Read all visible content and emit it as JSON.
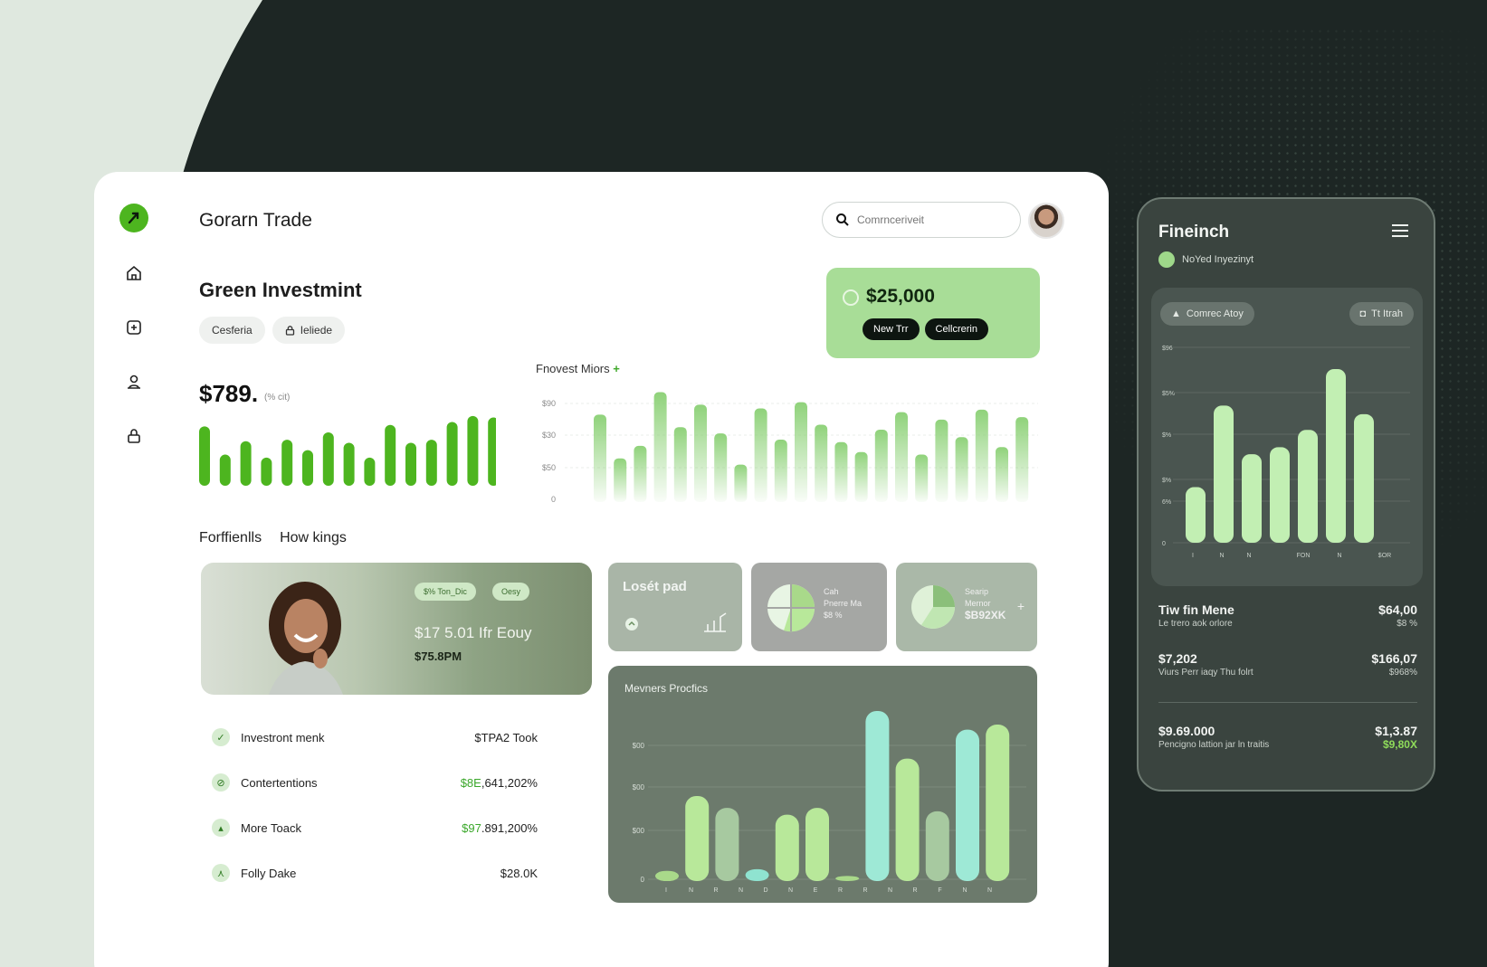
{
  "app": {
    "title": "Gorarn Trade"
  },
  "search": {
    "placeholder": "Comrnceriveit"
  },
  "page": {
    "title": "Green Investmint"
  },
  "chips": [
    {
      "label": "Cesferia",
      "icon": ""
    },
    {
      "label": "Ieliede",
      "icon": "lock-icon"
    }
  ],
  "promo": {
    "amount": "$25,000",
    "btn1": "New Trr",
    "btn2": "Cellcrerin"
  },
  "summary": {
    "value": "$789.",
    "sub": "(% cit)"
  },
  "chart_data": [
    {
      "type": "bar",
      "title": "",
      "values": [
        80,
        42,
        60,
        38,
        62,
        48,
        72,
        58,
        38,
        82,
        58,
        62,
        86,
        94,
        92
      ],
      "color": "#4db51f"
    },
    {
      "type": "bar",
      "title": "Fnovest Miors",
      "yticks": [
        "$90",
        "$30",
        "$50",
        "0"
      ],
      "values": [
        70,
        35,
        45,
        88,
        60,
        78,
        55,
        30,
        75,
        50,
        80,
        62,
        48,
        40,
        58,
        72,
        38,
        66,
        52,
        74,
        44,
        68
      ],
      "color": "#8fd27a"
    },
    {
      "type": "bar",
      "title": "Mevners Procfics",
      "yticks": [
        "$00",
        "$00",
        "$00",
        "0"
      ],
      "categories": [
        "I",
        "N",
        "R",
        "N",
        "D",
        "N",
        "E",
        "R",
        "R",
        "N",
        "R",
        "F",
        "N",
        "N"
      ],
      "values": [
        6,
        50,
        43,
        7,
        39,
        43,
        3,
        100,
        72,
        41,
        89,
        92
      ],
      "colors": [
        "#a9d98a",
        "#b8e89a",
        "#a7c9a0",
        "#8fe3d0",
        "#b8e89a",
        "#b8e89a",
        "#a9d98a",
        "#9ee9d6",
        "#b8e89a",
        "#a7c9a0",
        "#9ee9d6",
        "#b8e89a"
      ]
    },
    {
      "type": "bar",
      "title": "",
      "yticks": [
        "$96",
        "$5%",
        "$%",
        "$%",
        "6%",
        "0"
      ],
      "categories": [
        "I",
        "N",
        "N",
        "",
        "FON",
        "N",
        "$OR"
      ],
      "values": [
        32,
        79,
        51,
        55,
        65,
        100,
        74
      ],
      "color": "#c2efb3"
    }
  ],
  "tabs": {
    "tab1": "Forffienlls",
    "tab2": "How kings"
  },
  "feature": {
    "tag1": "$% Ton_Dic",
    "tag2": "Oesy",
    "line1": "$17 5.01 Ifr Eouy",
    "line2": "$75.8PM"
  },
  "stats": [
    {
      "label": "Investront menk",
      "value_prefix": "",
      "value": "$TPA2 Took"
    },
    {
      "label": "Contertentions",
      "value_prefix": "$8E",
      "value": ",641,202%"
    },
    {
      "label": "More Toack",
      "value_prefix": "$97",
      "value": ".891,200%"
    },
    {
      "label": "Folly Dake",
      "value_prefix": "",
      "value": "$28.0K"
    }
  ],
  "minis": {
    "m1": {
      "title": "Losét pad"
    },
    "m2": {
      "line1": "Cah",
      "line2": "Pnerre Ma",
      "line3": "$8 %"
    },
    "m3": {
      "line1": "Searip",
      "line2": "Mernor",
      "line3": "$B92XK"
    }
  },
  "phone": {
    "title": "Fineinch",
    "sub": "NoYed Inyezinyt",
    "chip1": "Comrec Atoy",
    "chip2": "Tt Itrah",
    "rows": [
      {
        "l1": "Tiw fin Mene",
        "l2": "Le trero aok orlore",
        "r1": "$64,00",
        "r2": "$8 %"
      },
      {
        "l1": "$7,202",
        "l2": "Viurs Perr iaqy Thu folrt",
        "r1": "$166,07",
        "r2": "$968%"
      },
      {
        "l1": "$9.69.000",
        "l2": "Pencigno lattion jar ln traitis",
        "r1": "$1,3.87",
        "r2": "$9,80X"
      }
    ]
  },
  "colors": {
    "brand": "#4db51f",
    "promo": "#a8dd97",
    "dark_bg": "#1d2624",
    "phone_bg": "#3a443f"
  }
}
